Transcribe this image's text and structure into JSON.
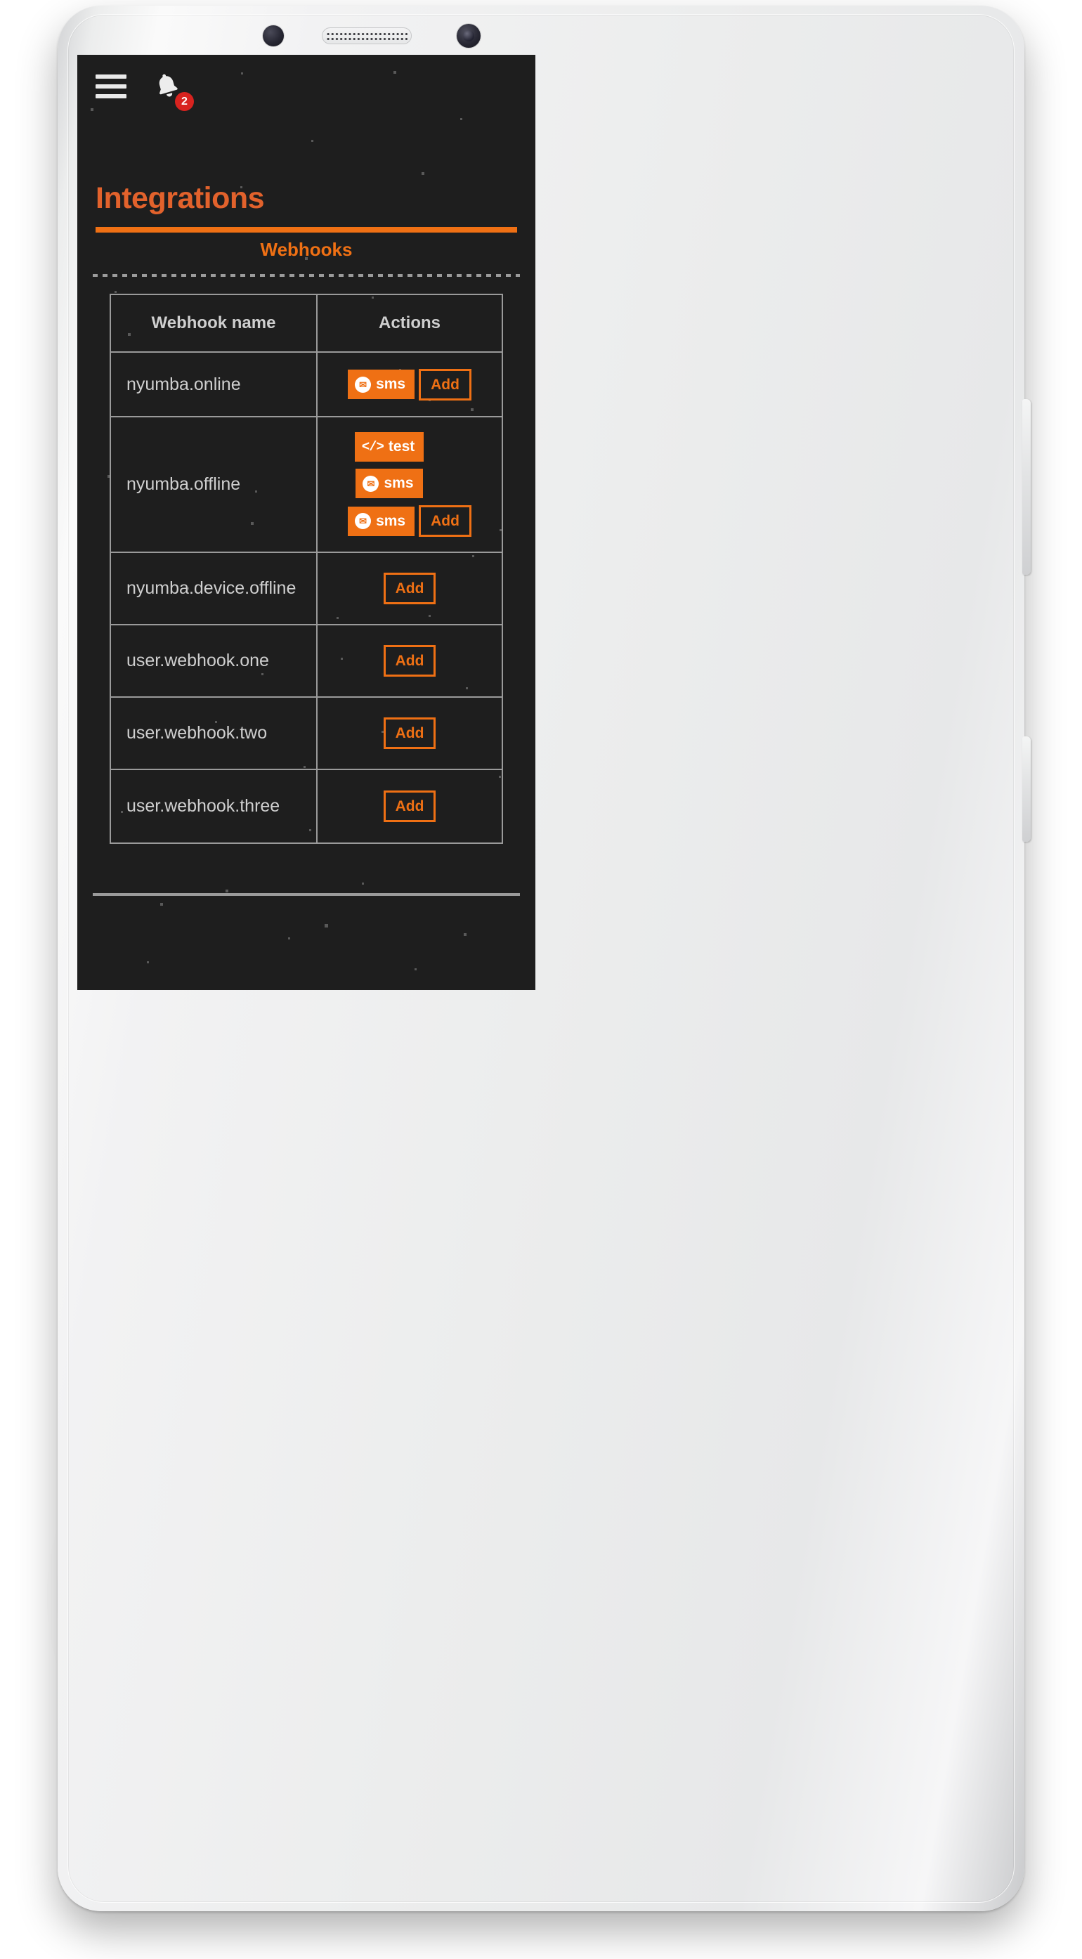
{
  "appbar": {
    "menu_icon": "hamburger-menu-icon",
    "notifications_icon": "bell-icon",
    "notifications_glyph": "ὑ4",
    "notification_count": "2",
    "badge_color": "#d8231f"
  },
  "page": {
    "title": "Integrations",
    "accent_color": "#ef7014",
    "title_color": "#e2622c",
    "background_color": "#1e1e1e"
  },
  "tabs": [
    {
      "label": "Webhooks",
      "active": true
    }
  ],
  "table": {
    "columns": [
      "Webhook name",
      "Actions"
    ],
    "rows": [
      {
        "name": "nyumba.online",
        "actions": [
          {
            "type": "sms",
            "label": "sms",
            "icon": "envelope-circle-icon",
            "style": "solid"
          },
          {
            "type": "add",
            "label": "Add",
            "style": "outline"
          }
        ]
      },
      {
        "name": "nyumba.offline",
        "actions": [
          {
            "type": "test",
            "label": "test",
            "icon": "code-brackets-icon",
            "style": "solid"
          },
          {
            "type": "sms",
            "label": "sms",
            "icon": "envelope-circle-icon",
            "style": "solid"
          },
          {
            "type": "sms",
            "label": "sms",
            "icon": "envelope-circle-icon",
            "style": "solid"
          },
          {
            "type": "add",
            "label": "Add",
            "style": "outline"
          }
        ]
      },
      {
        "name": "nyumba.device.offline",
        "actions": [
          {
            "type": "add",
            "label": "Add",
            "style": "outline"
          }
        ]
      },
      {
        "name": "user.webhook.one",
        "actions": [
          {
            "type": "add",
            "label": "Add",
            "style": "outline"
          }
        ]
      },
      {
        "name": "user.webhook.two",
        "actions": [
          {
            "type": "add",
            "label": "Add",
            "style": "outline"
          }
        ]
      },
      {
        "name": "user.webhook.three",
        "actions": [
          {
            "type": "add",
            "label": "Add",
            "style": "outline"
          }
        ]
      }
    ]
  },
  "icons": {
    "sms_glyph": "✉",
    "code_glyph": "</>"
  },
  "device": {
    "front_camera": "camera-icon",
    "earpiece_speaker": "speaker-grille",
    "volume_button": "volume-rocker",
    "power_button": "power-button"
  }
}
